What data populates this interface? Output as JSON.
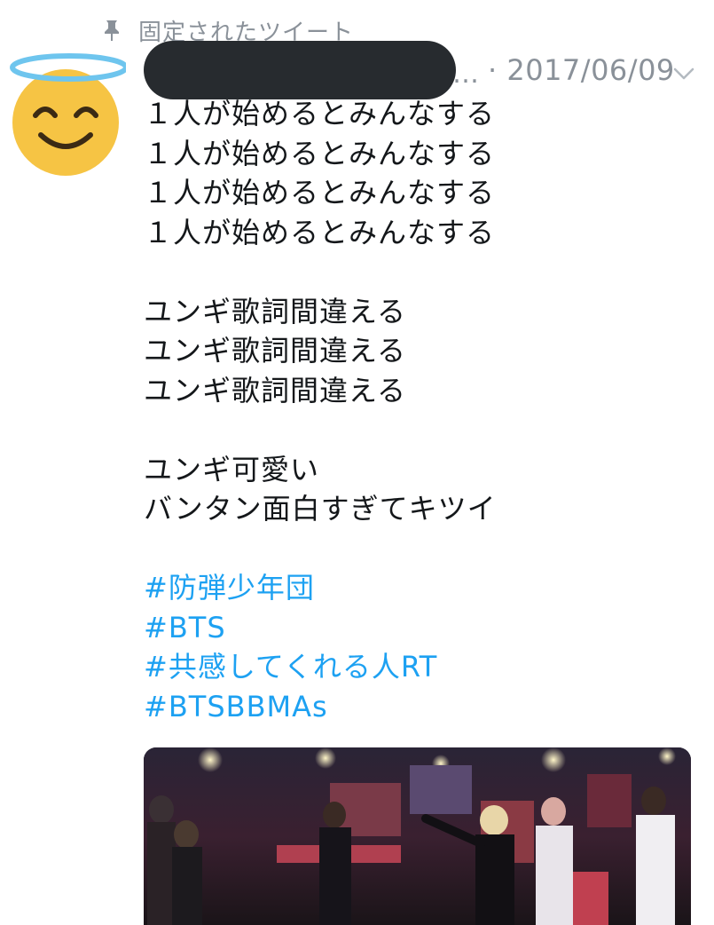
{
  "pinned": {
    "label": "固定されたツイート",
    "icon": "pin-icon"
  },
  "author": {
    "avatar_icon": "smiling-face-with-halo-emoji",
    "ellipsis": "…",
    "date": "· 2017/06/09",
    "menu_icon": "chevron-down-icon"
  },
  "tweet": {
    "block1": [
      "１人が始めるとみんなする",
      "１人が始めるとみんなする",
      "１人が始めるとみんなする",
      "１人が始めるとみんなする"
    ],
    "block2": [
      "ユンギ歌詞間違える",
      "ユンギ歌詞間違える",
      "ユンギ歌詞間違える"
    ],
    "block3": [
      "ユンギ可愛い",
      "バンタン面白すぎてキツイ"
    ],
    "hashtags": [
      "#防弾少年団",
      "#BTS",
      "#共感してくれる人RT",
      "#BTSBBMAs"
    ]
  },
  "colors": {
    "hashtag": "#1da1f2",
    "meta_text": "#8a9199",
    "redaction": "#272b2f",
    "avatar_face": "#f6c444"
  }
}
